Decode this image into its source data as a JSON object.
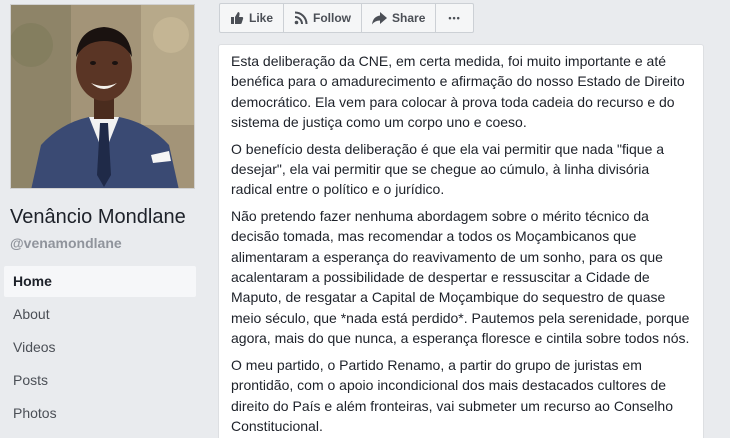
{
  "page": {
    "name": "Venâncio Mondlane",
    "handle": "@venamondlane"
  },
  "nav": {
    "items": [
      {
        "label": "Home",
        "active": true
      },
      {
        "label": "About",
        "active": false
      },
      {
        "label": "Videos",
        "active": false
      },
      {
        "label": "Posts",
        "active": false
      },
      {
        "label": "Photos",
        "active": false
      }
    ]
  },
  "actions": {
    "like_label": "Like",
    "follow_label": "Follow",
    "share_label": "Share",
    "more_label": "•••"
  },
  "post": {
    "paragraphs": [
      "Esta deliberação da CNE, em certa medida, foi muito importante e até benéfica para o amadurecimento e afirmação do nosso Estado de Direito democrático. Ela vem para colocar à prova toda cadeia do recurso e do sistema de justiça como um corpo uno e coeso.",
      "O benefício desta deliberação é que ela vai permitir que nada \"fique a desejar\", ela vai permitir que se chegue ao cúmulo, à linha divisória radical entre o político e o jurídico.",
      "Não pretendo fazer nenhuma abordagem sobre o mérito técnico da decisão tomada, mas recomendar a todos os Moçambicanos que alimentaram a esperança do reavivamento de um sonho, para os que acalentaram a possibilidade de despertar e ressuscitar a Cidade de Maputo, de resgatar a Capital de Moçambique do sequestro de quase meio século, que *nada está perdido*. Pautemos pela serenidade, porque agora, mais do que nunca, a esperança floresce e cintila sobre todos nós.",
      "O meu partido, o Partido Renamo, a partir do grupo de juristas em prontidão, com o apoio incondicional dos mais destacados cultores de direito do País e além fronteiras, vai submeter um recurso ao Conselho Constitucional."
    ]
  },
  "icons": {
    "like": "thumbs-up-icon",
    "follow": "rss-feed-icon",
    "share": "share-arrow-icon"
  },
  "colors": {
    "background": "#e9ebee",
    "card": "#ffffff",
    "text": "#1d2129",
    "muted": "#90949c",
    "button_bg": "#f5f6f7"
  }
}
